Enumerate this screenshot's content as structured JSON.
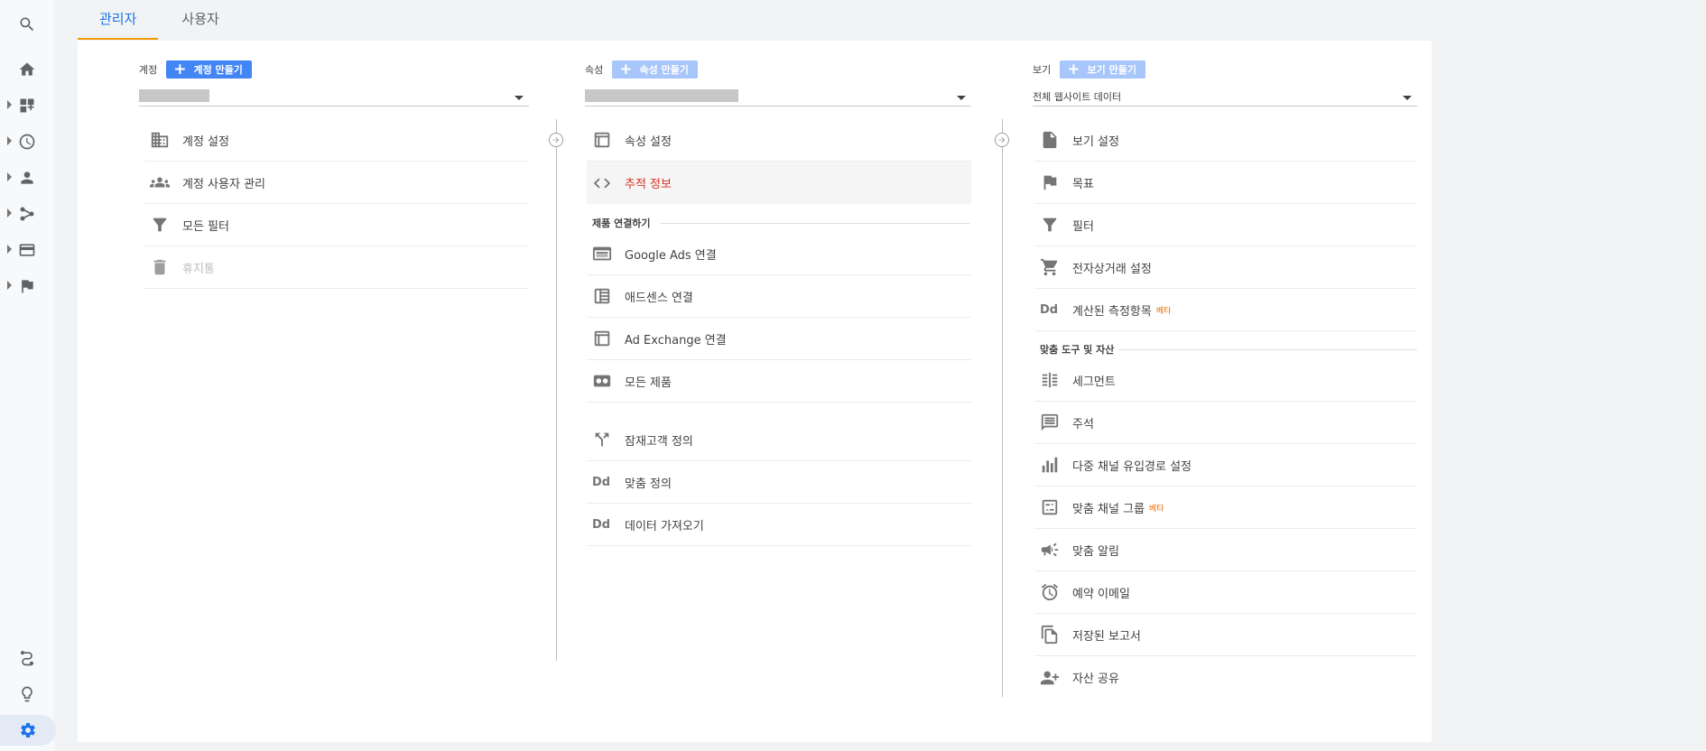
{
  "tabs": {
    "admin": "관리자",
    "users": "사용자"
  },
  "account": {
    "label": "계정",
    "create_button": "계정 만들기",
    "items": {
      "settings": "계정 설정",
      "user_management": "계정 사용자 관리",
      "all_filters": "모든 필터",
      "trash": "휴지통"
    }
  },
  "property": {
    "label": "속성",
    "create_button": "속성 만들기",
    "items": {
      "settings": "속성 설정",
      "tracking_info": "추적 정보"
    },
    "product_linking_title": "제품 연결하기",
    "linking": {
      "google_ads": "Google Ads 연결",
      "adsense": "애드센스 연결",
      "ad_exchange": "Ad Exchange 연결",
      "all_products": "모든 제품"
    },
    "more": {
      "audience": "잠재고객 정의",
      "custom_definitions": "맞춤 정의",
      "data_import": "데이터 가져오기"
    }
  },
  "view": {
    "label": "보기",
    "create_button": "보기 만들기",
    "selected": "전체 웹사이트 데이터",
    "items": {
      "settings": "보기 설정",
      "goals": "목표",
      "filters": "필터",
      "ecommerce": "전자상거래 설정",
      "calculated_metrics": "계산된 측정항목"
    },
    "beta_label": "베타",
    "tools_title": "맞춤 도구 및 자산",
    "tools": {
      "segments": "세그먼트",
      "annotations": "주석",
      "mcf_settings": "다중 채널 유입경로 설정",
      "custom_channel_grouping": "맞춤 채널 그룹",
      "custom_alerts": "맞춤 알림",
      "scheduled_emails": "예약 이메일",
      "saved_reports": "저장된 보고서",
      "share_assets": "자산 공유"
    }
  },
  "colors": {
    "accent": "#1a73e8",
    "tab_underline": "#f29900",
    "selected_text": "#d93025",
    "beta": "#e8710a",
    "button": "#4285f4"
  }
}
